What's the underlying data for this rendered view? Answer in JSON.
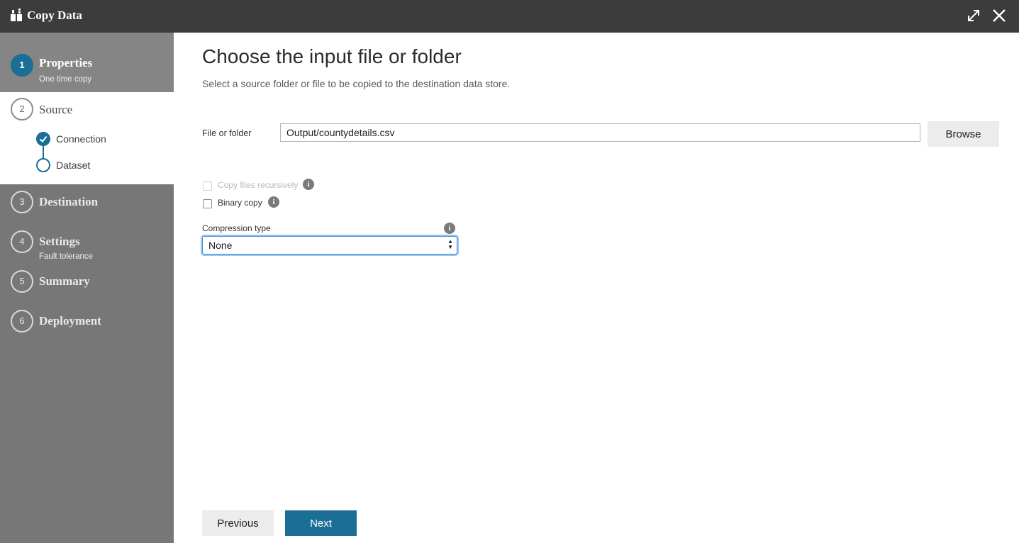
{
  "window": {
    "title": "Copy Data",
    "icon": "copy-data-icon",
    "expand_icon": "expand-icon",
    "close_icon": "close-icon"
  },
  "steps": [
    {
      "number": "1",
      "label": "Properties",
      "sub": "One time copy",
      "state": "complete"
    },
    {
      "number": "2",
      "label": "Source",
      "sub": "",
      "state": "current",
      "substeps": [
        {
          "label": "Connection",
          "state": "done"
        },
        {
          "label": "Dataset",
          "state": "current"
        }
      ]
    },
    {
      "number": "3",
      "label": "Destination",
      "sub": "",
      "state": "pending"
    },
    {
      "number": "4",
      "label": "Settings",
      "sub": "Fault tolerance",
      "state": "pending"
    },
    {
      "number": "5",
      "label": "Summary",
      "sub": "",
      "state": "pending"
    },
    {
      "number": "6",
      "label": "Deployment",
      "sub": "",
      "state": "pending"
    }
  ],
  "main": {
    "title": "Choose the input file or folder",
    "description": "Select a source folder or file to be copied to the destination data store.",
    "file_label": "File or folder",
    "file_value": "Output/countydetails.csv",
    "browse_label": "Browse",
    "copy_recursive_label": "Copy files recursively",
    "binary_copy_label": "Binary copy",
    "compression_label": "Compression type",
    "compression_value": "None",
    "info_glyph": "i"
  },
  "footer": {
    "previous_label": "Previous",
    "next_label": "Next"
  },
  "colors": {
    "accent": "#1b6e96",
    "titlebar": "#3c3c3c",
    "sidebar": "#777777"
  }
}
